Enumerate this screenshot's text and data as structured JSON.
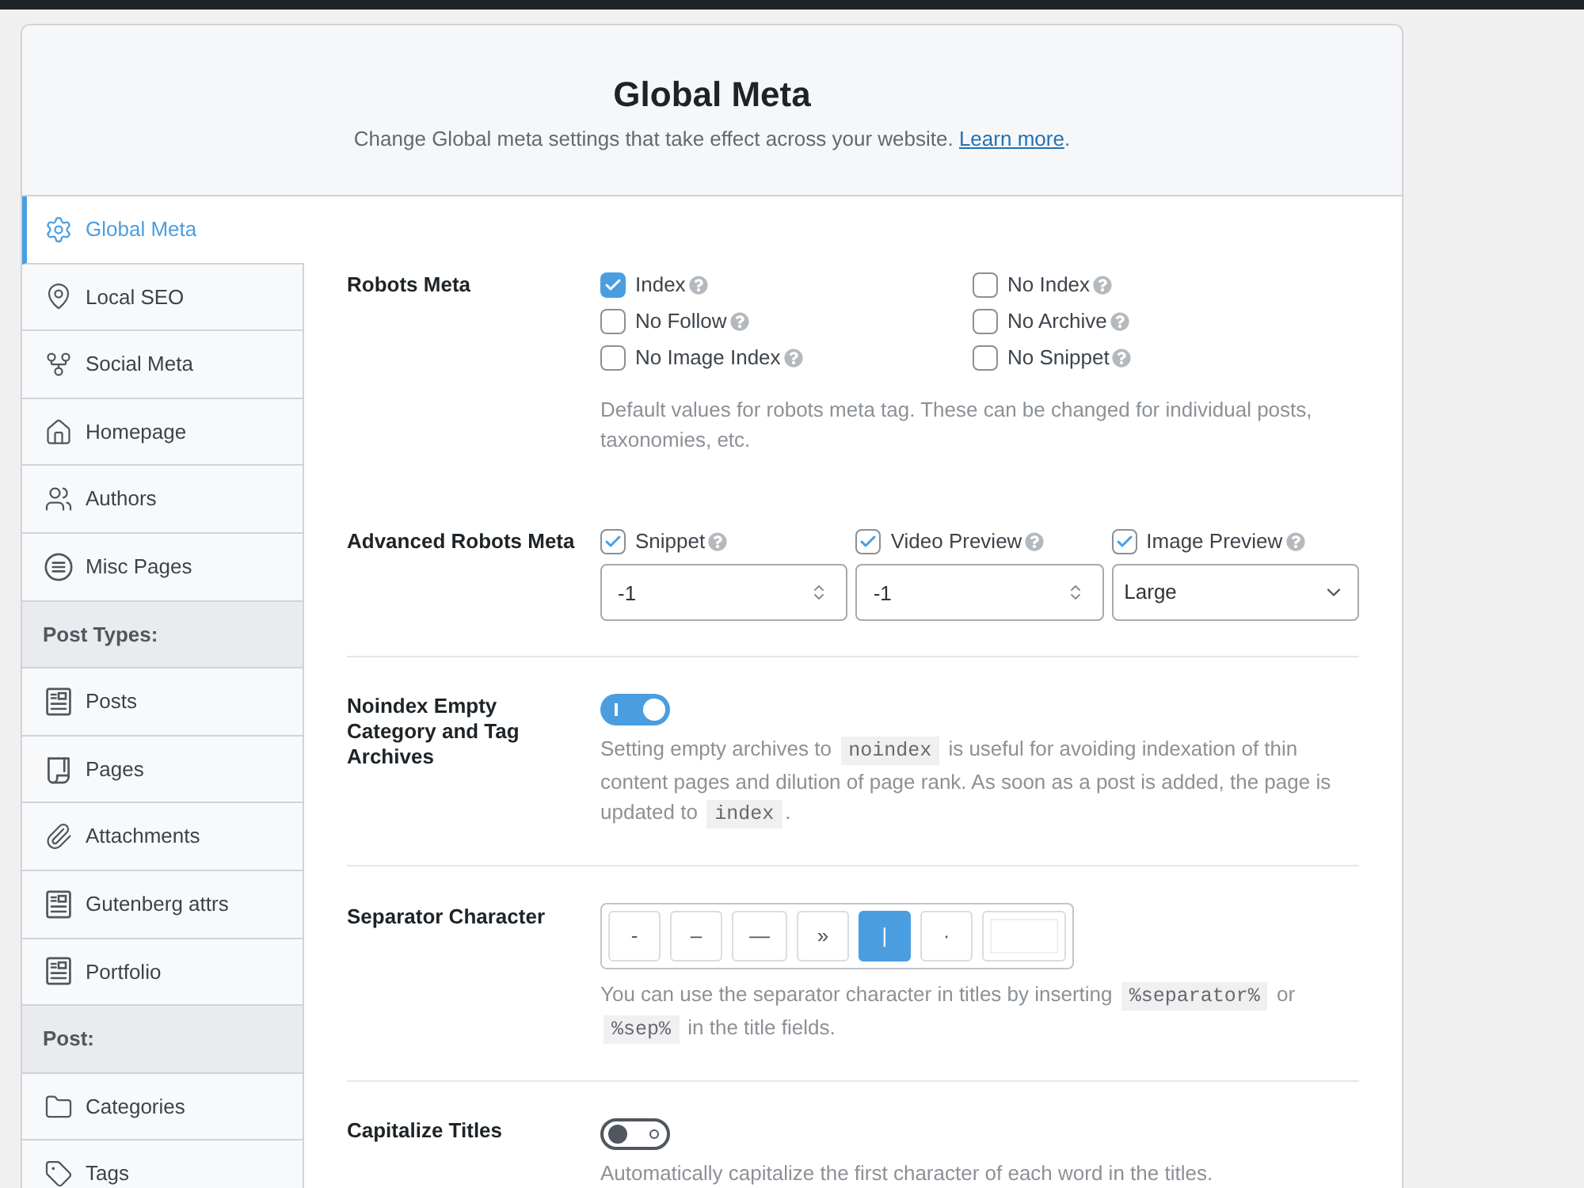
{
  "header": {
    "title": "Global Meta",
    "subtitle": {
      "text": "Change Global meta settings that take effect across your website. ",
      "link": "Learn more",
      "after": "."
    }
  },
  "sidebar": {
    "items": [
      {
        "kind": "item",
        "label": "Global Meta",
        "selected": true
      },
      {
        "kind": "item",
        "label": "Local SEO",
        "selected": false
      },
      {
        "kind": "item",
        "label": "Social Meta",
        "selected": false
      },
      {
        "kind": "item",
        "label": "Homepage",
        "selected": false
      },
      {
        "kind": "item",
        "label": "Authors",
        "selected": false
      },
      {
        "kind": "item",
        "label": "Misc Pages",
        "selected": false
      },
      {
        "kind": "group",
        "label": "Post Types:"
      },
      {
        "kind": "item",
        "label": "Posts",
        "selected": false
      },
      {
        "kind": "item",
        "label": "Pages",
        "selected": false
      },
      {
        "kind": "item",
        "label": "Attachments",
        "selected": false
      },
      {
        "kind": "item",
        "label": "Gutenberg attrs",
        "selected": false
      },
      {
        "kind": "item",
        "label": "Portfolio",
        "selected": false
      },
      {
        "kind": "group",
        "label": "Post:"
      },
      {
        "kind": "item",
        "label": "Categories",
        "selected": false
      },
      {
        "kind": "item",
        "label": "Tags",
        "selected": false
      }
    ]
  },
  "sections": [
    {
      "kind": "checkbox_grid",
      "label": "Robots Meta",
      "divider": false,
      "options": [
        {
          "label": "Index",
          "checked": true
        },
        {
          "label": "No Follow",
          "checked": false
        },
        {
          "label": "No Image Index",
          "checked": false
        },
        {
          "label": "No Index",
          "checked": false
        },
        {
          "label": "No Archive",
          "checked": false
        },
        {
          "label": "No Snippet",
          "checked": false
        }
      ],
      "description": [
        {
          "kind": "text",
          "text": "Default values for robots meta tag. These can be changed for individual posts, taxonomies, etc."
        }
      ]
    },
    {
      "kind": "advanced",
      "label": "Advanced Robots Meta",
      "divider": false,
      "fields": [
        {
          "kind": "number",
          "label": "Snippet",
          "checked": true,
          "value": "-1"
        },
        {
          "kind": "number",
          "label": "Video Preview",
          "checked": true,
          "value": "-1"
        },
        {
          "kind": "select",
          "label": "Image Preview",
          "checked": true,
          "value": "Large"
        }
      ]
    },
    {
      "kind": "toggle",
      "label": "Noindex Empty Category and Tag Archives",
      "divider": true,
      "on": true,
      "description": [
        {
          "kind": "text",
          "text": "Setting empty archives to "
        },
        {
          "kind": "code",
          "text": "noindex"
        },
        {
          "kind": "text",
          "text": " is useful for avoiding indexation of thin content pages and dilution of page rank. As soon as a post is added, the page is updated to "
        },
        {
          "kind": "code",
          "text": "index"
        },
        {
          "kind": "text",
          "text": "."
        }
      ]
    },
    {
      "kind": "separator",
      "label": "Separator Character",
      "divider": true,
      "options": [
        {
          "char": "-",
          "selected": false
        },
        {
          "char": "–",
          "selected": false
        },
        {
          "char": "—",
          "selected": false
        },
        {
          "char": "»",
          "selected": false
        },
        {
          "char": "|",
          "selected": true
        },
        {
          "char": "·",
          "selected": false
        }
      ],
      "description": [
        {
          "kind": "text",
          "text": "You can use the separator character in titles by inserting "
        },
        {
          "kind": "code",
          "text": "%separator%"
        },
        {
          "kind": "text",
          "text": " or "
        },
        {
          "kind": "code",
          "text": "%sep%"
        },
        {
          "kind": "text",
          "text": " in the title fields."
        }
      ]
    },
    {
      "kind": "toggle",
      "label": "Capitalize Titles",
      "divider": true,
      "on": false,
      "description": [
        {
          "kind": "text",
          "text": "Automatically capitalize the first character of each word in the titles."
        }
      ]
    }
  ]
}
